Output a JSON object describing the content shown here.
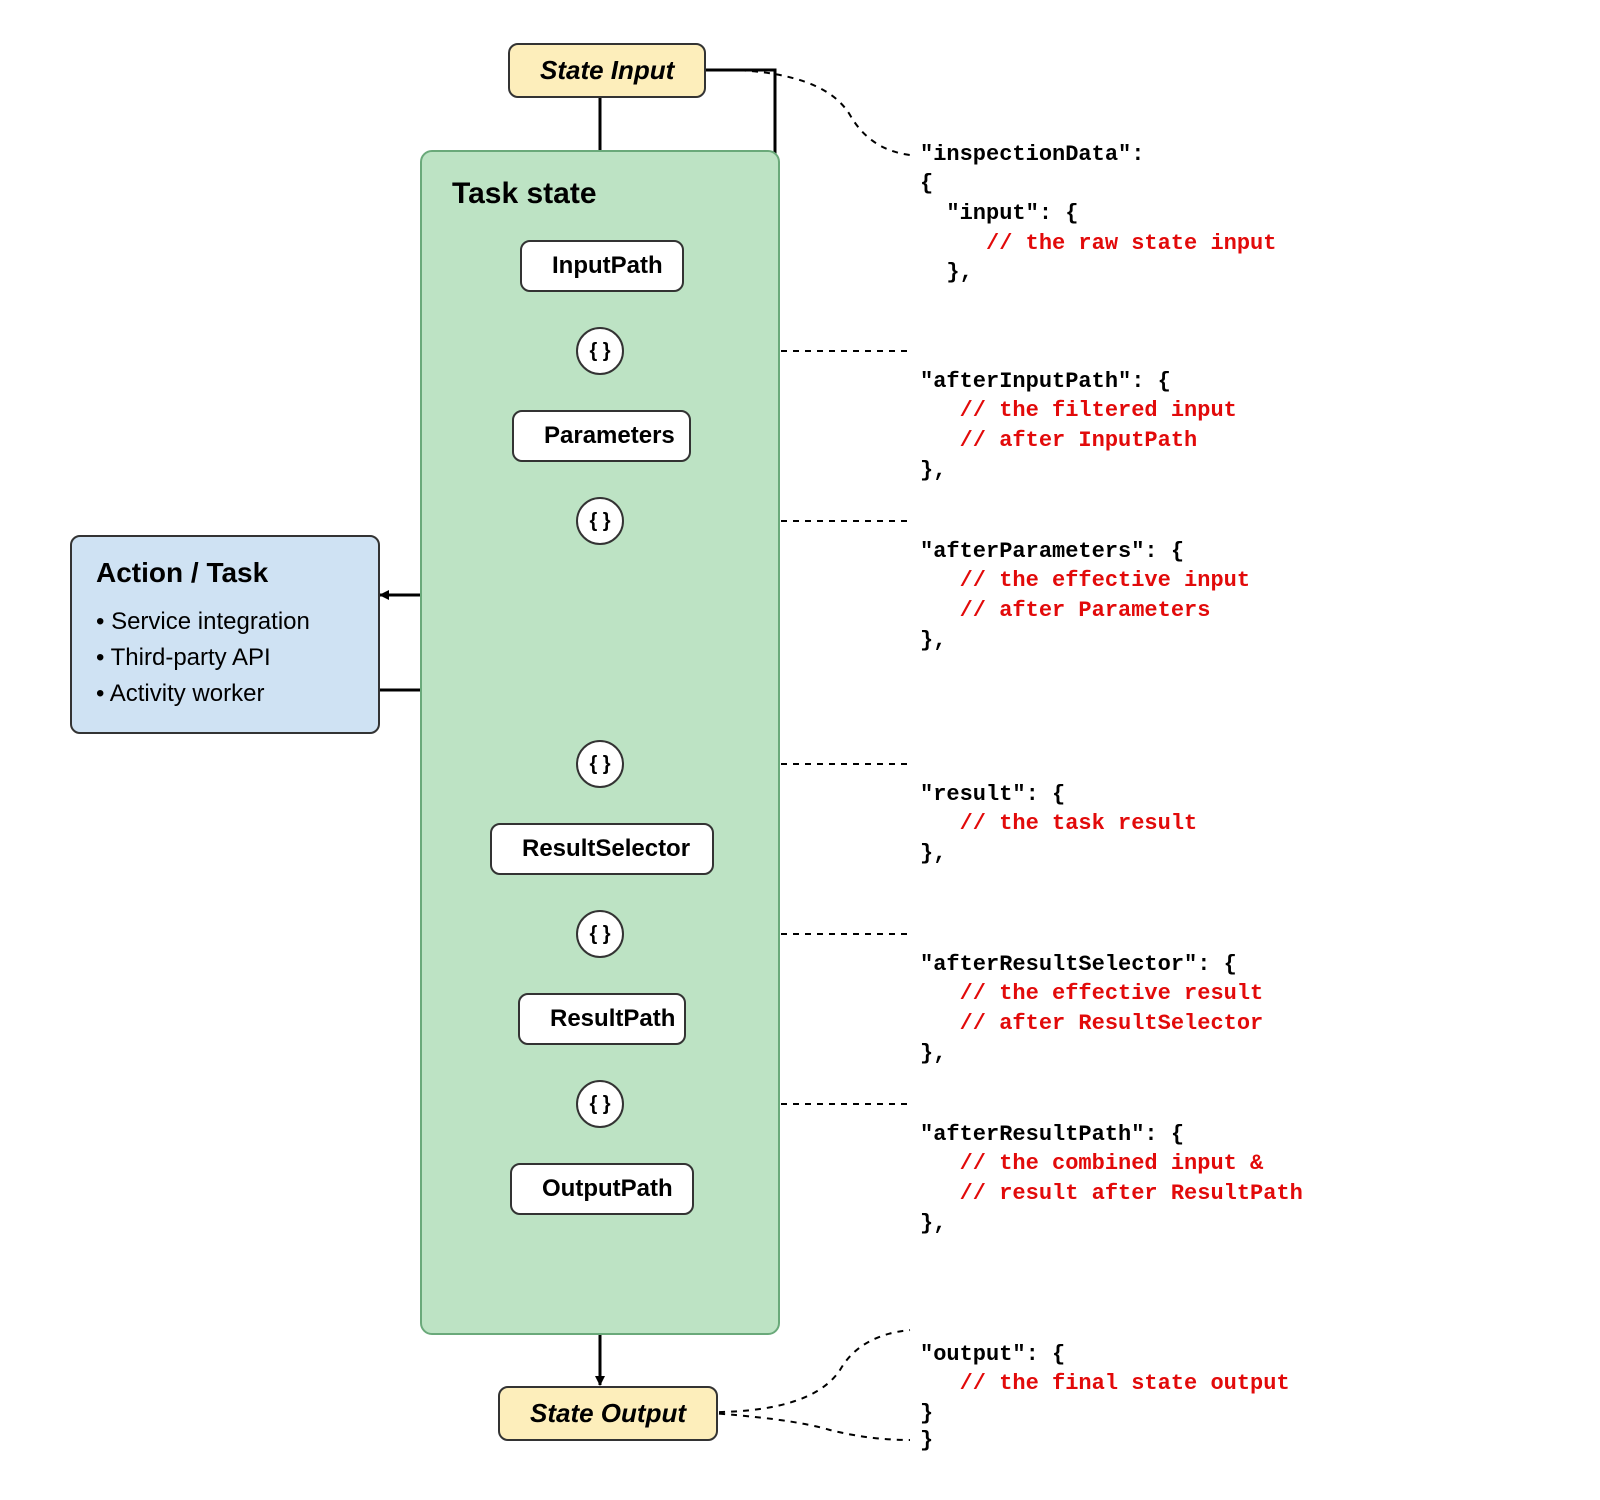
{
  "stateInput": "State Input",
  "stateOutput": "State Output",
  "taskStateTitle": "Task state",
  "stages": {
    "inputPath": "InputPath",
    "parameters": "Parameters",
    "resultSelector": "ResultSelector",
    "resultPath": "ResultPath",
    "outputPath": "OutputPath"
  },
  "bracesGlyph": "{ }",
  "actionBox": {
    "title": "Action / Task",
    "items": [
      "Service integration",
      "Third-party API",
      "Activity worker"
    ]
  },
  "annotations": {
    "header": "\"inspectionData\":\n{",
    "input": {
      "key": "  \"input\": {",
      "comment": "     // the raw state input",
      "close": "  },"
    },
    "afterInputPath": {
      "key": "\"afterInputPath\": {",
      "comment1": "   // the filtered input",
      "comment2": "   // after InputPath",
      "close": "},"
    },
    "afterParameters": {
      "key": "\"afterParameters\": {",
      "comment1": "   // the effective input",
      "comment2": "   // after Parameters",
      "close": "},"
    },
    "result": {
      "key": "\"result\": {",
      "comment": "   // the task result",
      "close": "},"
    },
    "afterResultSelector": {
      "key": "\"afterResultSelector\": {",
      "comment1": "   // the effective result",
      "comment2": "   // after ResultSelector",
      "close": "},"
    },
    "afterResultPath": {
      "key": "\"afterResultPath\": {",
      "comment1": "   // the combined input &",
      "comment2": "   // result after ResultPath",
      "close": "},"
    },
    "output": {
      "key": "\"output\": {",
      "comment": "   // the final state output",
      "close": "}"
    },
    "footerClose": "}"
  }
}
